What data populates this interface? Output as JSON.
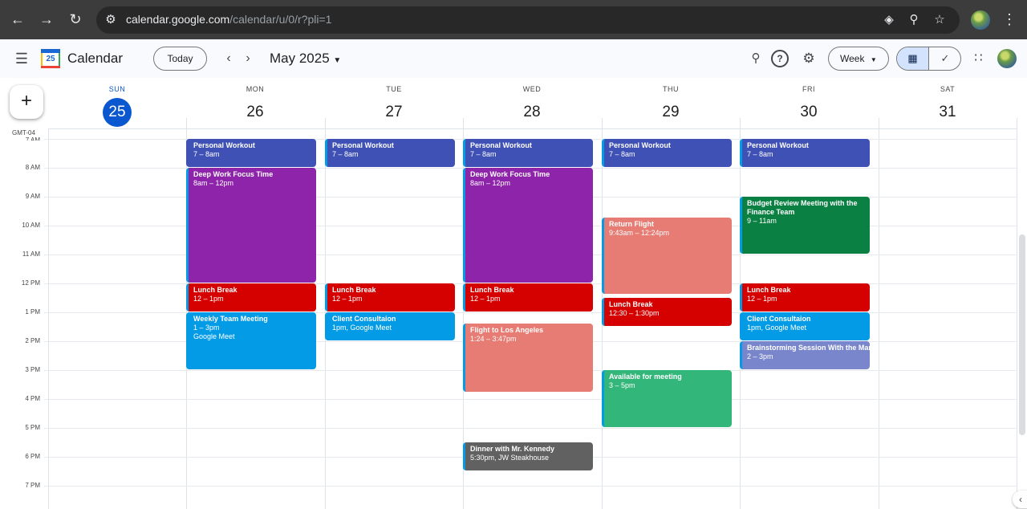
{
  "browser": {
    "url_host": "calendar.google.com",
    "url_path": "/calendar/u/0/r?pli=1"
  },
  "header": {
    "app_title": "Calendar",
    "logo_number": "25",
    "today_label": "Today",
    "month_title": "May 2025",
    "view_label": "Week"
  },
  "timezone": "GMT-04",
  "days": [
    {
      "name": "SUN",
      "num": "25",
      "today": true
    },
    {
      "name": "MON",
      "num": "26"
    },
    {
      "name": "TUE",
      "num": "27"
    },
    {
      "name": "WED",
      "num": "28"
    },
    {
      "name": "THU",
      "num": "29"
    },
    {
      "name": "FRI",
      "num": "30"
    },
    {
      "name": "SAT",
      "num": "31"
    }
  ],
  "hours": [
    "7 AM",
    "8 AM",
    "9 AM",
    "10 AM",
    "11 AM",
    "12 PM",
    "1 PM",
    "2 PM",
    "3 PM",
    "4 PM",
    "5 PM",
    "6 PM",
    "7 PM"
  ],
  "colors": {
    "workout": "#3f51b5",
    "focus": "#8e24aa",
    "lunch": "#d50000",
    "meeting": "#039be5",
    "flight": "#e67c73",
    "budget": "#0b8043",
    "available": "#33b679",
    "brainstorm": "#7986cb",
    "dinner": "#616161",
    "today_accent": "#0b57d0"
  },
  "events": [
    {
      "title": "Personal Workout",
      "time": "7 – 8am"
    },
    {
      "title": "Deep Work Focus Time",
      "time": "8am – 12pm"
    },
    {
      "title": "Lunch Break",
      "time": "12 – 1pm"
    },
    {
      "title": "Weekly Team Meeting",
      "time": "1 – 3pm",
      "location": "Google Meet"
    },
    {
      "title": "Personal Workout",
      "time": "7 – 8am"
    },
    {
      "title": "Lunch Break",
      "time": "12 – 1pm"
    },
    {
      "title": "Client Consultaion",
      "time": "1pm, Google Meet"
    },
    {
      "title": "Personal Workout",
      "time": "7 – 8am"
    },
    {
      "title": "Deep Work Focus Time",
      "time": "8am – 12pm"
    },
    {
      "title": "Lunch Break",
      "time": "12 – 1pm"
    },
    {
      "title": "Flight to Los Angeles",
      "time": "1:24 – 3:47pm"
    },
    {
      "title": "Dinner with Mr. Kennedy",
      "time": "5:30pm, JW Steakhouse"
    },
    {
      "title": "Personal Workout",
      "time": "7 – 8am"
    },
    {
      "title": "Return Flight",
      "time": "9:43am – 12:24pm"
    },
    {
      "title": "Lunch Break",
      "time": "12:30 – 1:30pm"
    },
    {
      "title": "Available for meeting",
      "time": "3 – 5pm"
    },
    {
      "title": "Personal Workout",
      "time": "7 – 8am"
    },
    {
      "title": "Budget Review Meeting with the Finance Team",
      "time": "9 – 11am"
    },
    {
      "title": "Lunch Break",
      "time": "12 – 1pm"
    },
    {
      "title": "Client Consultaion",
      "time": "1pm, Google Meet"
    },
    {
      "title": "Brainstorming Session With the Marketing Team",
      "time": "2 – 3pm"
    }
  ]
}
